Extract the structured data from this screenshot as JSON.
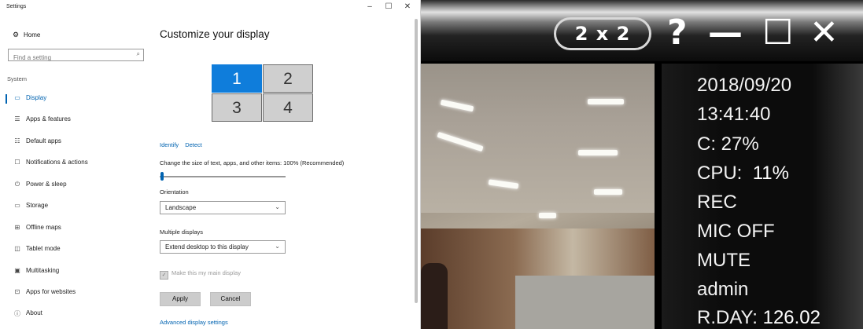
{
  "settings": {
    "window_title": "Settings",
    "controls": {
      "minimize": "–",
      "maximize": "☐",
      "close": "✕"
    },
    "home": "Home",
    "search_placeholder": "Find a setting",
    "section": "System",
    "nav": [
      {
        "label": "Display",
        "icon": "monitor-icon",
        "glyph": "▭",
        "active": true
      },
      {
        "label": "Apps & features",
        "icon": "list-icon",
        "glyph": "☰"
      },
      {
        "label": "Default apps",
        "icon": "default-apps-icon",
        "glyph": "☷"
      },
      {
        "label": "Notifications & actions",
        "icon": "notification-icon",
        "glyph": "☐"
      },
      {
        "label": "Power & sleep",
        "icon": "power-icon",
        "glyph": "⏻"
      },
      {
        "label": "Storage",
        "icon": "storage-icon",
        "glyph": "▭"
      },
      {
        "label": "Offline maps",
        "icon": "map-icon",
        "glyph": "⊞"
      },
      {
        "label": "Tablet mode",
        "icon": "tablet-icon",
        "glyph": "◫"
      },
      {
        "label": "Multitasking",
        "icon": "multitasking-icon",
        "glyph": "▣"
      },
      {
        "label": "Apps for websites",
        "icon": "web-apps-icon",
        "glyph": "⊡"
      },
      {
        "label": "About",
        "icon": "info-icon",
        "glyph": "ⓘ"
      }
    ],
    "heading": "Customize your display",
    "monitors": [
      "1",
      "2",
      "3",
      "4"
    ],
    "identify": "Identify",
    "detect": "Detect",
    "scale_label": "Change the size of text, apps, and other items: 100% (Recommended)",
    "scale_value_percent": 100,
    "orientation_label": "Orientation",
    "orientation_value": "Landscape",
    "multiple_label": "Multiple displays",
    "multiple_value": "Extend desktop to this display",
    "main_display": "Make this my main display",
    "apply": "Apply",
    "cancel": "Cancel",
    "advanced": "Advanced display settings"
  },
  "viewer": {
    "layout_button": "2 x 2",
    "help": "?",
    "minimize": "—",
    "maximize": "☐",
    "close": "✕",
    "info": {
      "date": "2018/09/20",
      "time": "13:41:40",
      "disk": "C:  27%",
      "cpu_label": "CPU:",
      "cpu_value": "11%",
      "rec": "REC",
      "mic": "MIC OFF",
      "mute": "MUTE",
      "user": "admin",
      "rday_label": "R.DAY:",
      "rday_value": "126.02"
    }
  }
}
